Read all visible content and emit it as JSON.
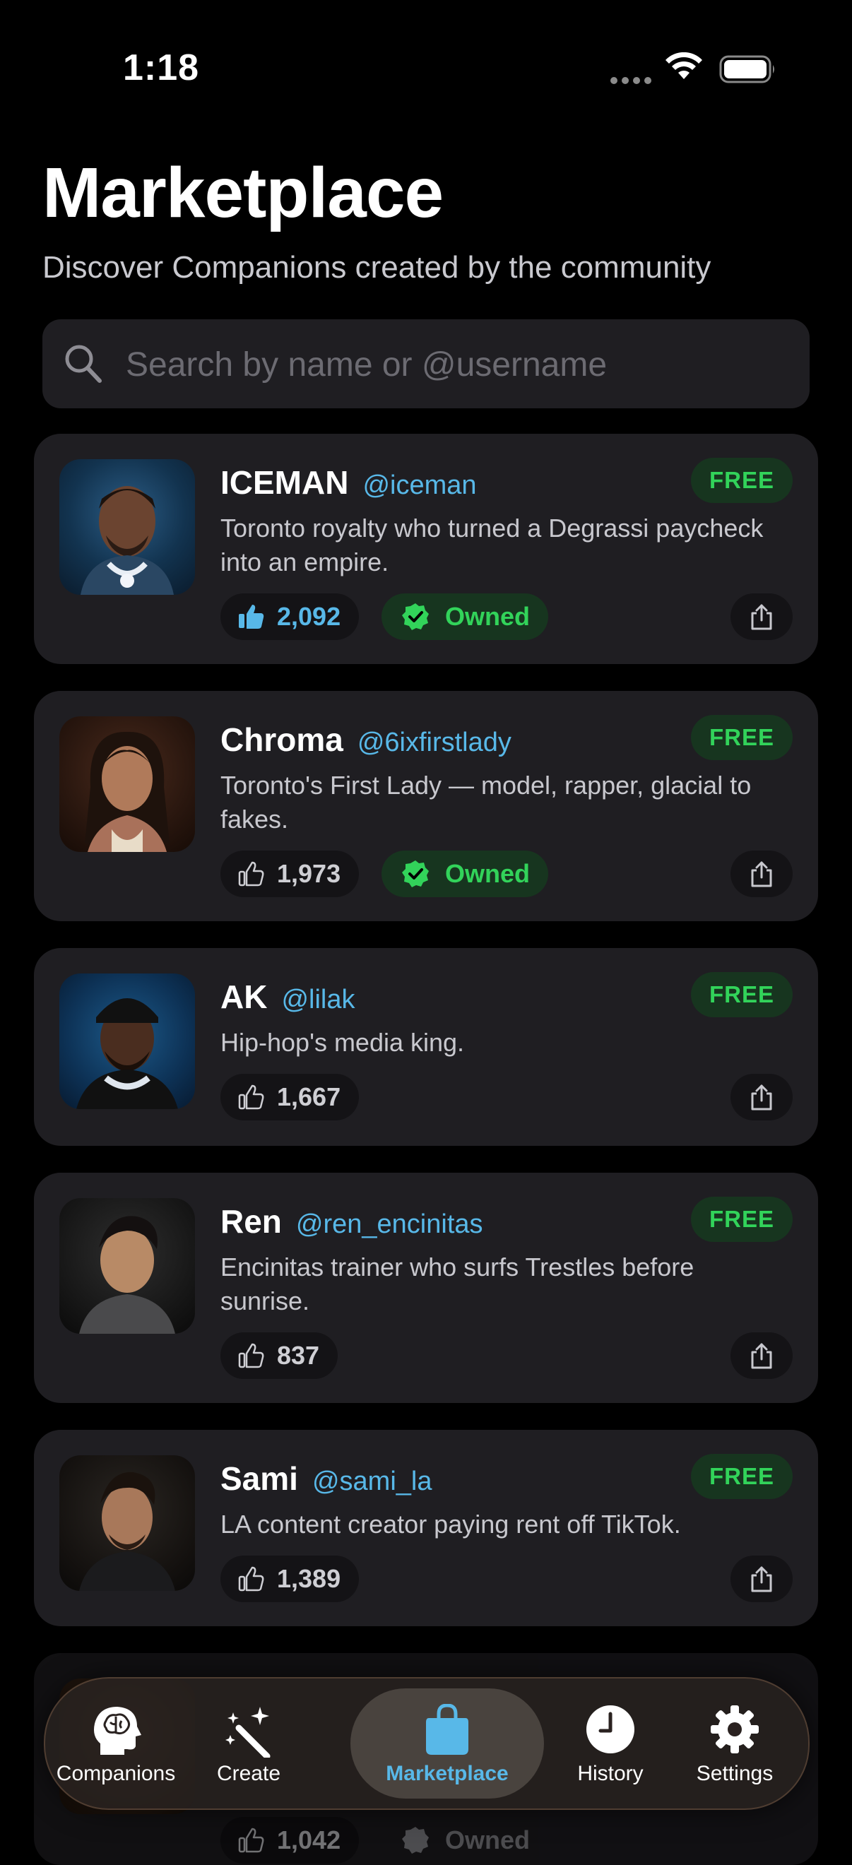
{
  "status_bar": {
    "time": "1:18"
  },
  "header": {
    "title": "Marketplace",
    "subtitle": "Discover Companions created by the community"
  },
  "search": {
    "placeholder": "Search by name or @username",
    "value": ""
  },
  "companions": [
    {
      "name": "ICEMAN",
      "handle": "@iceman",
      "badge": "FREE",
      "description": "Toronto royalty who turned a Degrassi paycheck into an empire.",
      "likes": "2,092",
      "liked": true,
      "owned": true,
      "owned_label": "Owned"
    },
    {
      "name": "Chroma",
      "handle": "@6ixfirstlady",
      "badge": "FREE",
      "description": "Toronto's First Lady — model, rapper, glacial to fakes.",
      "likes": "1,973",
      "liked": false,
      "owned": true,
      "owned_label": "Owned"
    },
    {
      "name": "AK",
      "handle": "@lilak",
      "badge": "FREE",
      "description": "Hip-hop's media king.",
      "likes": "1,667",
      "liked": false,
      "owned": false
    },
    {
      "name": "Ren",
      "handle": "@ren_encinitas",
      "badge": "FREE",
      "description": "Encinitas trainer who surfs Trestles before sunrise.",
      "likes": "837",
      "liked": false,
      "owned": false
    },
    {
      "name": "Sami",
      "handle": "@sami_la",
      "badge": "FREE",
      "description": "LA content creator paying rent off TikTok.",
      "likes": "1,389",
      "liked": false,
      "owned": false
    },
    {
      "name": "",
      "handle": "",
      "badge": "",
      "description": "",
      "likes": "1,042",
      "liked": false,
      "owned": true,
      "owned_label": "Owned"
    }
  ],
  "tab_bar": {
    "active": "Marketplace",
    "tabs": [
      {
        "label": "Companions",
        "icon": "brain-head-icon"
      },
      {
        "label": "Create",
        "icon": "magic-wand-icon"
      },
      {
        "label": "Marketplace",
        "icon": "shopping-bag-icon"
      },
      {
        "label": "History",
        "icon": "clock-icon"
      },
      {
        "label": "Settings",
        "icon": "gear-icon"
      }
    ]
  },
  "colors": {
    "background": "#000000",
    "card": "#1f1e22",
    "accent_blue": "#58b8e8",
    "free_green": "#32d35a",
    "free_bg": "#17351f"
  }
}
